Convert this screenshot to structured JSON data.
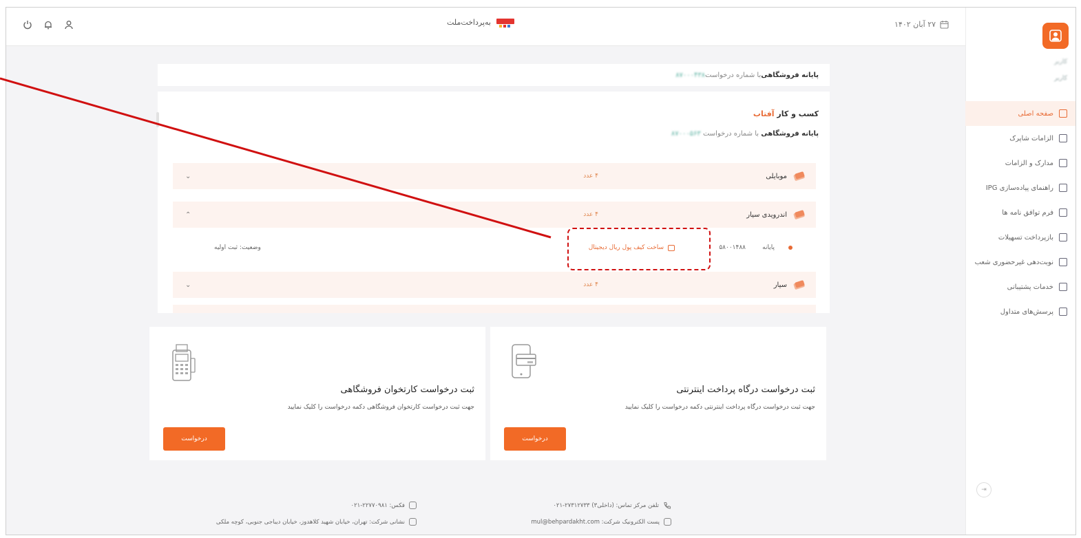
{
  "header": {
    "logo_text": "به‌پرداخت‌ملت",
    "date": "۲۷ آبان ۱۴۰۲",
    "icons": [
      "power-icon",
      "bell-icon",
      "user-icon"
    ]
  },
  "sidebar": {
    "user_name": "کاربر",
    "user_role": "کاربر",
    "items": [
      {
        "label": "صفحه اصلی",
        "icon": "home-icon",
        "active": true
      },
      {
        "label": "الزامات شاپرک",
        "icon": "document-icon"
      },
      {
        "label": "مدارک و الزامات",
        "icon": "id-card-icon"
      },
      {
        "label": "راهنمای پیاده‌سازی IPG",
        "icon": "guide-icon"
      },
      {
        "label": "فرم توافق نامه ها",
        "icon": "form-icon"
      },
      {
        "label": "بازپرداخت تسهیلات",
        "icon": "card-icon"
      },
      {
        "label": "نوبت‌دهی غیرحضوری شعب",
        "icon": "calendar-icon"
      },
      {
        "label": "خدمات پشتیبانی",
        "icon": "mail-icon"
      },
      {
        "label": "پرسش‌های متداول",
        "icon": "chat-icon"
      }
    ]
  },
  "main": {
    "top_card": {
      "strong": "پایانه فروشگاهی",
      "text": " با شماره درخواست ",
      "request_no": "۸۷۰۰۰۴۳۸"
    },
    "business": {
      "title_prefix": "کسب و کار ",
      "title_name": "آفتاب",
      "sub_strong": "پایانه فروشگاهی",
      "sub_text": " با شماره درخواست ",
      "request_no": "۸۷۰۰۰۵۶۳"
    },
    "accordion": [
      {
        "name": "موبایلی",
        "count": "۴ عدد",
        "chevron": "chevron-down-icon",
        "symbol": "⌄"
      },
      {
        "name": "اندرویدی سیار",
        "count": "۴ عدد",
        "chevron": "chevron-up-icon",
        "symbol": "⌃"
      },
      {
        "name": "سیار",
        "count": "۴ عدد",
        "chevron": "chevron-down-icon",
        "symbol": "⌄"
      }
    ],
    "terminal": {
      "label": "پایانه",
      "number": "۵۸۰۰۱۴۸۸",
      "link": "ساخت کیف پول ریال دیجیتال",
      "status": "وضعیت: ثبت اولیه"
    }
  },
  "requests": {
    "ipg": {
      "title": "ثبت درخواست درگاه پرداخت اینترنتی",
      "desc": "جهت ثبت درخواست درگاه پرداخت اینترنتی دکمه درخواست را کلیک نمایید",
      "button": "درخواست"
    },
    "pos": {
      "title": "ثبت درخواست کارتخوان فروشگاهی",
      "desc": "جهت ثبت درخواست کارتخوان فروشگاهی دکمه درخواست را کلیک نمایید",
      "button": "درخواست"
    }
  },
  "footer": {
    "phone": "تلفن مرکز تماس: (داخلی۳) ۲۷۳۱۲۷۳۳-۰۲۱",
    "fax": "فکس: ۲۲۷۷۰۹۸۱-۰۲۱",
    "email": "پست الکترونیک شرکت: mul@behpardakht.com",
    "address": "نشانی شرکت: تهران، خیابان شهید کلاهدوز، خیابان دیباجی جنوبی، کوچه ملکی"
  },
  "colors": {
    "accent": "#f26a26",
    "annotation": "#d01010"
  }
}
